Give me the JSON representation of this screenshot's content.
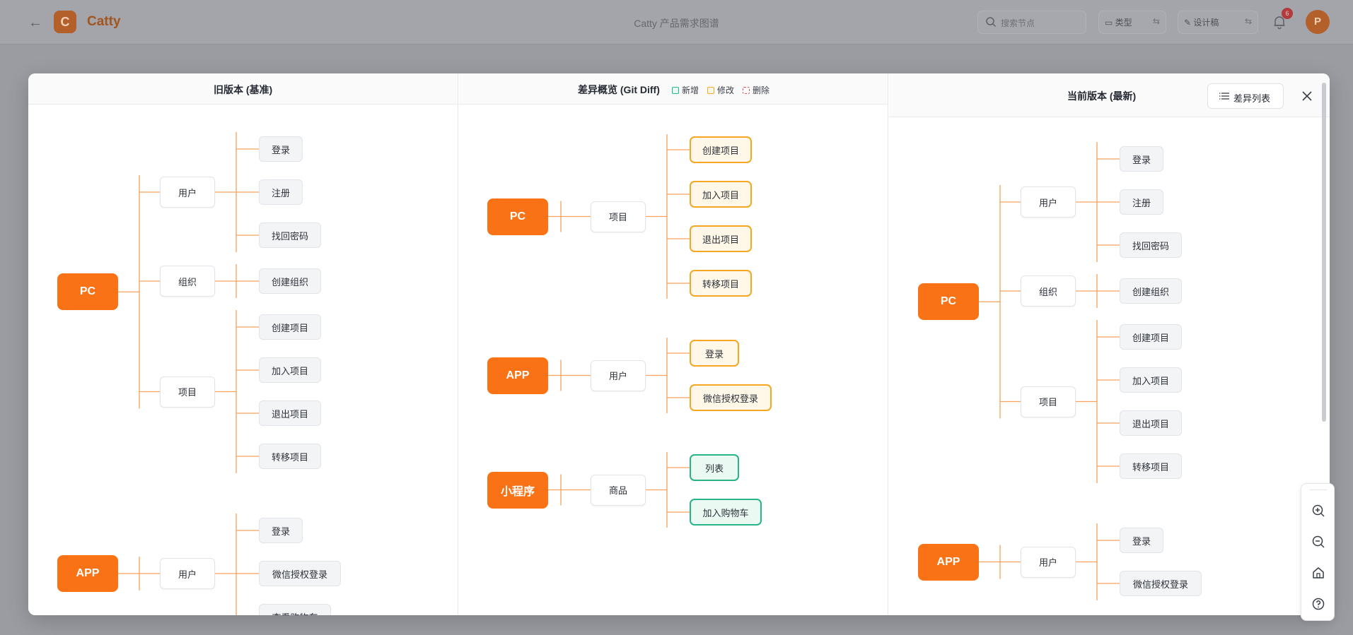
{
  "app": {
    "name": "Catty",
    "logo_letter": "C",
    "doc_title": "Catty 产品需求图谱",
    "search_placeholder": "搜索节点",
    "mode_type_label": "类型",
    "mode_design_label": "设计稿",
    "notifications_count": "6",
    "avatar_letter": "P"
  },
  "modal": {
    "old_title": "旧版本 (基准)",
    "diff_title": "差异概览 (Git Diff)",
    "new_title": "当前版本 (最新)",
    "legend": {
      "added": "新增",
      "modified": "修改",
      "deleted": "删除"
    },
    "diff_list_button": "差异列表"
  },
  "colors": {
    "accent": "#f97316",
    "added": "#27b587",
    "modified": "#f5a623",
    "deleted": "#e05252",
    "link": "#f6a25a"
  },
  "old_tree": [
    {
      "label": "PC",
      "children": [
        {
          "label": "用户",
          "children": [
            "登录",
            "注册",
            "找回密码"
          ]
        },
        {
          "label": "组织",
          "children": [
            "创建组织"
          ]
        },
        {
          "label": "项目",
          "children": [
            "创建项目",
            "加入项目",
            "退出项目",
            "转移项目"
          ]
        }
      ]
    },
    {
      "label": "APP",
      "children": [
        {
          "label": "用户",
          "children": [
            "登录",
            "微信授权登录",
            "查看购物车"
          ]
        }
      ]
    }
  ],
  "diff_tree": [
    {
      "label": "PC",
      "children": [
        {
          "label": "项目",
          "children": [
            {
              "label": "创建项目",
              "status": "modified"
            },
            {
              "label": "加入项目",
              "status": "modified"
            },
            {
              "label": "退出项目",
              "status": "modified"
            },
            {
              "label": "转移项目",
              "status": "modified"
            }
          ]
        }
      ]
    },
    {
      "label": "APP",
      "children": [
        {
          "label": "用户",
          "children": [
            {
              "label": "登录",
              "status": "modified"
            },
            {
              "label": "微信授权登录",
              "status": "modified"
            }
          ]
        }
      ]
    },
    {
      "label": "小程序",
      "children": [
        {
          "label": "商品",
          "children": [
            {
              "label": "列表",
              "status": "added"
            },
            {
              "label": "加入购物车",
              "status": "added"
            }
          ]
        }
      ]
    }
  ],
  "new_tree": [
    {
      "label": "PC",
      "children": [
        {
          "label": "用户",
          "children": [
            "登录",
            "注册",
            "找回密码"
          ]
        },
        {
          "label": "组织",
          "children": [
            "创建组织"
          ]
        },
        {
          "label": "项目",
          "children": [
            "创建项目",
            "加入项目",
            "退出项目",
            "转移项目"
          ]
        }
      ]
    },
    {
      "label": "APP",
      "children": [
        {
          "label": "用户",
          "children": [
            "登录",
            "微信授权登录"
          ]
        }
      ]
    }
  ],
  "zoom_controls": [
    "zoom-in-icon",
    "zoom-out-icon",
    "home-icon",
    "help-icon"
  ]
}
